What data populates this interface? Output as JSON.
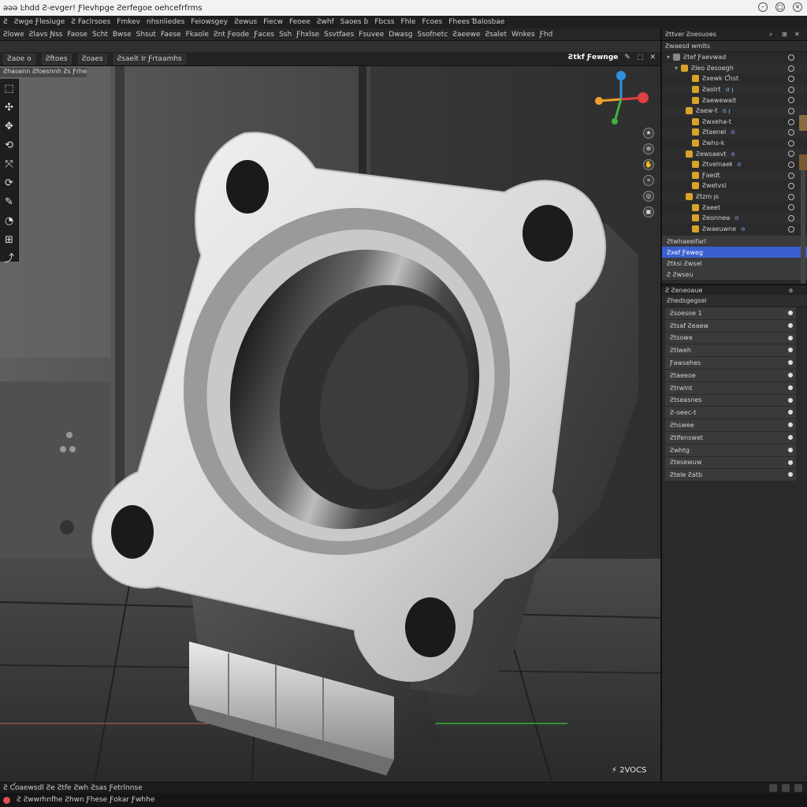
{
  "window": {
    "title": "ǝǝǝ  Ŀhdd Ƨ-evger!  Ƒlevhpge  Ƨerfegoe  oehcefrfrms"
  },
  "menubar": {
    "items": [
      "Ƨ",
      "Ƨwge Ƒlesiuge",
      "Ƨ Faclrsoes",
      "Fmkev",
      "nhsnliedes",
      "Feiowsgey",
      "Ƨewus",
      "Fiecw",
      "Feoee",
      "Ƨwhf",
      "Saoes ɓ",
      "Fbcss",
      "Fhle",
      "Fcoes",
      "Fhees Ɓalosbae"
    ]
  },
  "toolbar": {
    "items": [
      "Ƨlowe",
      "Ƨlavs Ɲss",
      "Faose",
      "Scht",
      "Bwse",
      "Shsut",
      "Faese",
      "Fkaole",
      "Ƨnt Ƒeode",
      "Ƒaces",
      "Ssh",
      "Ƒhxlse",
      "Ssvtfaes",
      "Fsuvee",
      "Dwasg",
      "Ssofnetc",
      "Ƨaeewe",
      "Ƨsalet",
      "Wnkes",
      "Ƒhd"
    ]
  },
  "header": {
    "tabs": [
      "Ƨaoe o",
      "Ƨftoes",
      "Ƨoaes",
      "Ƨsaelt Ir Ƒrtaamhs"
    ],
    "object_name": "Ƨtkf Ƒewnge",
    "viewport_note": "Ƨhasenn Ƨfoesnnh Ƨs Ƒrhes"
  },
  "tools": [
    {
      "icon": "select-box-icon",
      "glyph": "⬚"
    },
    {
      "icon": "cursor-icon",
      "glyph": "✣"
    },
    {
      "icon": "move-icon",
      "glyph": "✥"
    },
    {
      "icon": "rotate-icon",
      "glyph": "⟲"
    },
    {
      "icon": "scale-icon",
      "glyph": "⤧"
    },
    {
      "icon": "transform-icon",
      "glyph": "⟳"
    },
    {
      "icon": "annotate-icon",
      "glyph": "✎"
    },
    {
      "icon": "measure-icon",
      "glyph": "◔"
    },
    {
      "icon": "add-cube-icon",
      "glyph": "⊞"
    },
    {
      "icon": "extrude-icon",
      "glyph": "⤴"
    }
  ],
  "viewport_icons": [
    "★",
    "⊕",
    "✋",
    "⌖",
    "◎",
    "▣"
  ],
  "viewport_corner": "⚡ 2VOCS",
  "outliner": {
    "header": "Ƨttver Ƨoesuoes",
    "sub_header": "Ƨwaesd wmlts",
    "root": "Ƨtef Ƒaevwad",
    "scene": "Ƨleo Ƨesoegh",
    "items": [
      {
        "label": "Ƨxewk Ƈhst",
        "color": "#d9a32a",
        "sub": ""
      },
      {
        "label": "Ƨaolrt",
        "color": "#d9a32a",
        "sub": "ɞ ɟ"
      },
      {
        "label": "Ƨaewewalt",
        "color": "#d9a32a",
        "sub": ""
      },
      {
        "label": "Ƨaew-t",
        "color": "#d9a32a",
        "sub": "ɞ ɟ"
      },
      {
        "label": "Ƨwxeha-t",
        "color": "#d9a32a",
        "sub": ""
      },
      {
        "label": "Ƨtaenel",
        "color": "#d9a32a",
        "sub": "ɞ"
      },
      {
        "label": "Ƨwhs-k",
        "color": "#d9a32a",
        "sub": ""
      },
      {
        "label": "Ƨewsaevt",
        "color": "#d9a32a",
        "sub": "ɞ"
      },
      {
        "label": "Ƨtvelnaeŧ",
        "color": "#d9a32a",
        "sub": "ɞ"
      },
      {
        "label": "Ƒaedt",
        "color": "#d9a32a",
        "sub": ""
      },
      {
        "label": "Ƨwetvsl",
        "color": "#d9a32a",
        "sub": ""
      },
      {
        "label": "Ƨtzm ɟs",
        "color": "#d9a32a",
        "sub": ""
      },
      {
        "label": "Ƨaeet",
        "color": "#d9a32a",
        "sub": ""
      },
      {
        "label": "Ƨeonneʉ",
        "color": "#d9a32a",
        "sub": "ɞ"
      },
      {
        "label": "Ƨwaeuwne",
        "color": "#d9a32a",
        "sub": "ɞ"
      }
    ],
    "collections": [
      {
        "label": "Ƨtwhaeelfarl",
        "selected": false
      },
      {
        "label": "Ƨxef Ƒeweg",
        "selected": true
      },
      {
        "label": "Ƨtksi Ƨwsel",
        "selected": false
      },
      {
        "label": "Ƨ Ƨwseu",
        "selected": false
      }
    ]
  },
  "properties": {
    "header": "Ƨ Ƨeneoaue",
    "header_right": "ɞ",
    "group": "Ƨhedsgegsei",
    "rows": [
      "Ƨsoesoe 1",
      "Ƨtsaf Ƨeaew",
      "Ƨtsowe",
      "Ƨtlweh",
      "Ƒawsehes",
      "Ƨtaeeoe",
      "Ƨtrwlnt",
      "Ƨtseasnes",
      "Ƨ-oeec-t",
      "Ƨhswee",
      "Ƨtlfenswet",
      "Ƨwhtg",
      "Ƨtesewuw",
      "Ƨtele Ƨatb"
    ]
  },
  "status": {
    "strip_text": "Ƨ Ƈoaewsdl Ƨe Ƨtfe Ƨwh Ƨsas Ƒetrlnnse",
    "bar_text": "Ƨ Ƨwwrhnfhe Ƨhwn Ƒhese Ƒokar Ƒwhhe"
  },
  "colors": {
    "accent_selected": "#3c5fcf",
    "axis_x": "#e04040",
    "axis_y": "#40b040",
    "axis_z": "#2f8fe0",
    "folder_icon": "#d9a32a"
  }
}
